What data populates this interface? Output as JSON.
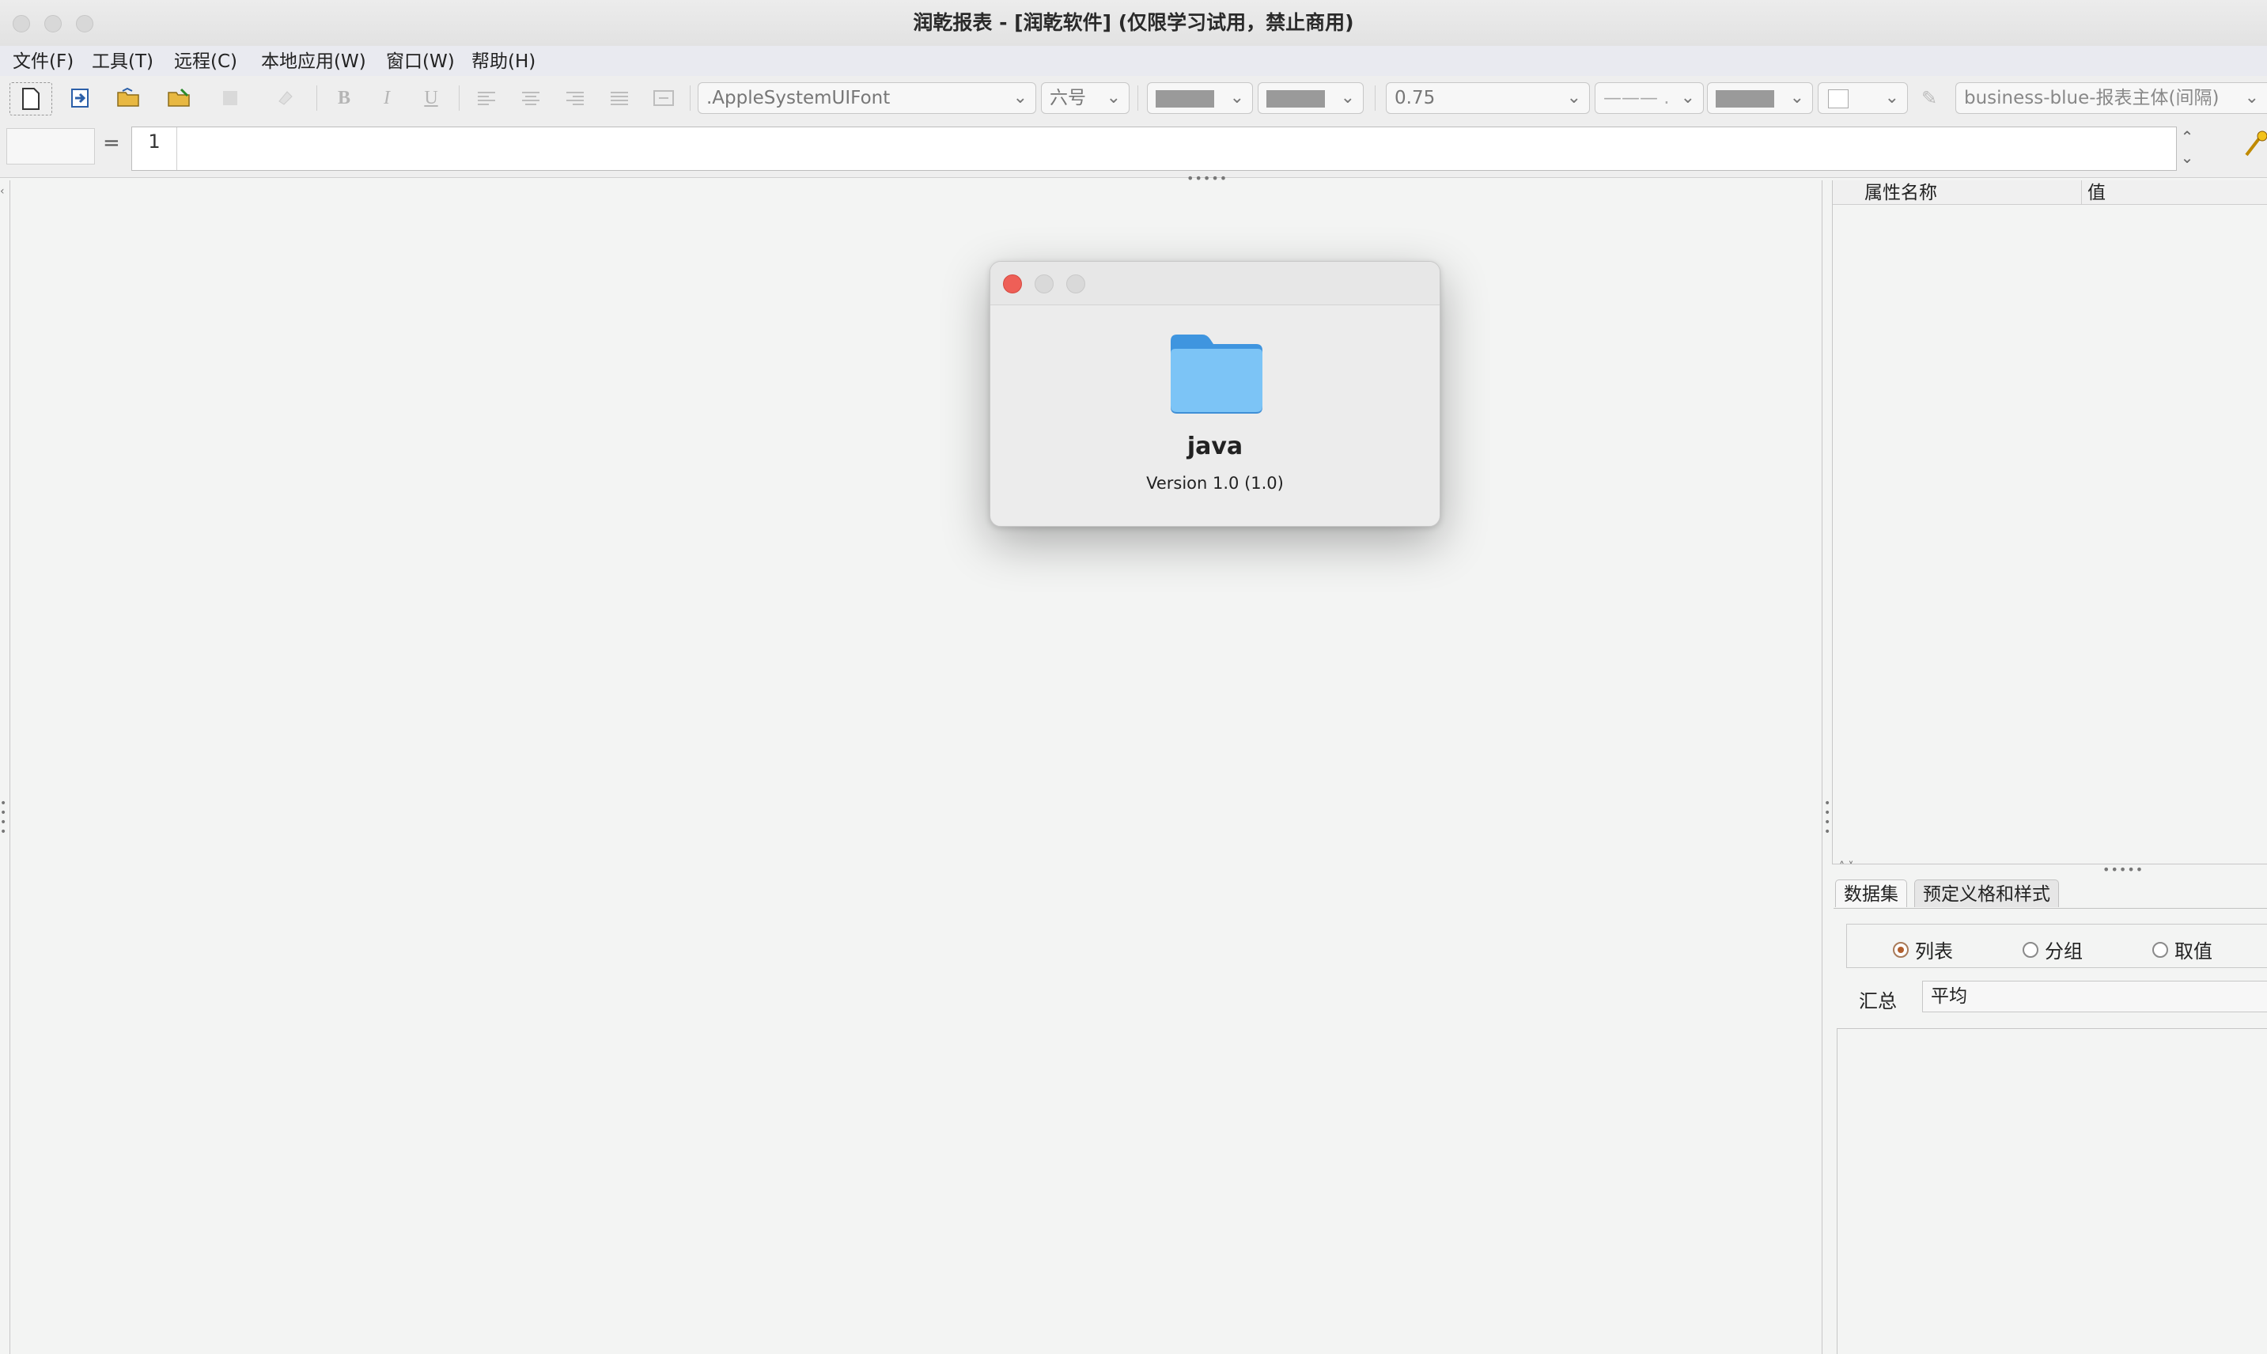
{
  "window": {
    "title": "润乾报表 - [润乾软件] (仅限学习试用，禁止商用)"
  },
  "menu": {
    "items": [
      "文件(F)",
      "工具(T)",
      "远程(C)",
      "本地应用(W)",
      "窗口(W)",
      "帮助(H)"
    ]
  },
  "toolbar": {
    "font_family": ".AppleSystemUIFont",
    "font_size": "六号",
    "line_width": "0.75",
    "line_style": "——— .",
    "style_preset": "business-blue-报表主体(间隔)",
    "bold_label": "B",
    "italic_label": "I",
    "underline_label": "U"
  },
  "formula_bar": {
    "cell_ref": "",
    "equals": "=",
    "row_number": "1",
    "value": ""
  },
  "properties_panel": {
    "col_name": "属性名称",
    "col_value": "值"
  },
  "dataset_panel": {
    "tabs": [
      "数据集",
      "预定义格和样式"
    ],
    "radio_options": [
      "列表",
      "分组",
      "取值"
    ],
    "selected_radio": "列表",
    "summary_label": "汇总",
    "summary_value": "平均"
  },
  "about_dialog": {
    "app_name": "java",
    "version": "Version 1.0 (1.0)"
  },
  "colors": {
    "close_red": "#ee5f57",
    "folder_blue": "#5aaef0"
  }
}
